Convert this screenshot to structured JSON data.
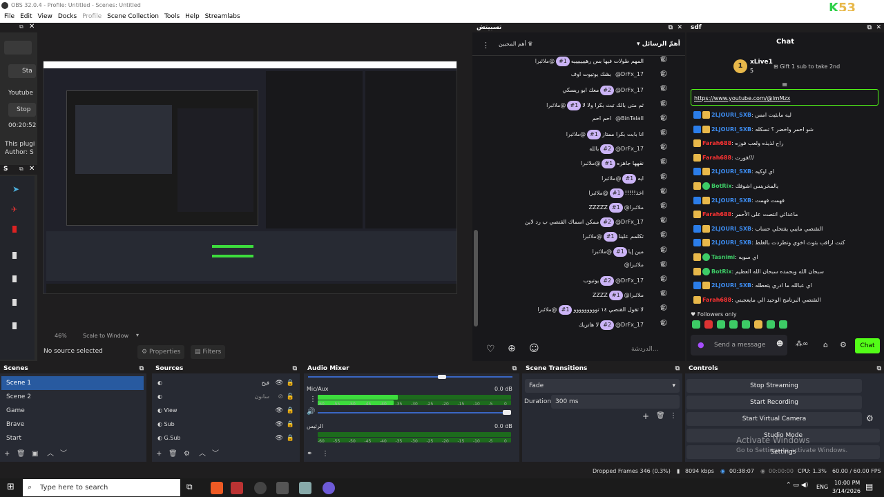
{
  "titlebar": {
    "title": "OBS 32.0.4 - Profile: Untitled - Scenes: Untitled",
    "brand": "53",
    "brand_k": "K"
  },
  "menu": {
    "items": [
      "File",
      "Edit",
      "View",
      "Docks",
      "Profile",
      "Scene Collection",
      "Tools",
      "Help",
      "Streamlabs"
    ]
  },
  "leftdock": {
    "start_label": "Sta",
    "youtube_label": "Youtube",
    "stop_label": "Stop",
    "timer": "00:20:52",
    "plugin_text": "This plugi",
    "author_text": "Author: S",
    "dock2_title": "S"
  },
  "preview": {
    "zoom": "46%",
    "scale_mode": "Scale to Window",
    "no_source": "No source selected",
    "properties": "Properties",
    "filters": "Filters",
    "inner_caption": "Activate Windows"
  },
  "chatpop": {
    "title": "تسبيتش",
    "filter_label": "أهمّ الرسائل",
    "top_btn": "أهم المحبين",
    "input_placeholder": "الدردشة...",
    "lines": [
      {
        "user": "@ملائبرا",
        "rank": "#1",
        "text": "المهم طولات فيها بس رهيييييييه"
      },
      {
        "user": "@DrFx_17",
        "rank": "",
        "text": "بشك يوتيوت اوف"
      },
      {
        "user": "@DrFx_17",
        "rank": "#2",
        "text": "معك ابو ريسكي"
      },
      {
        "user": "@ملائبرا",
        "rank": "#1",
        "text": "ثم متى بالك تبث بكرا ولا لا"
      },
      {
        "user": "@BinTalall",
        "rank": "",
        "text": "احم احم"
      },
      {
        "user": "@ملائبرا",
        "rank": "#1",
        "text": "انا بابت بكرا ممتاز"
      },
      {
        "user": "@DrFx_17",
        "rank": "#2",
        "text": "بالله"
      },
      {
        "user": "@ملائبرا",
        "rank": "#1",
        "text": "نقهها جاهزه"
      },
      {
        "user": "@ملائبرا",
        "rank": "#1",
        "text": "ايه"
      },
      {
        "user": "@ملائبرا",
        "rank": "#1",
        "text": "اخذ!!!!!"
      },
      {
        "user": "@ملائبرا",
        "rank": "#1",
        "text": "ZZZZZ"
      },
      {
        "user": "@DrFx_17",
        "rank": "#2",
        "text": "ممكن اسماك القنصي ب رد لاين"
      },
      {
        "user": "@ملائبرا",
        "rank": "#1",
        "text": "تكلمم علينا"
      },
      {
        "user": "@ملائبرا",
        "rank": "#1",
        "text": "مين إيا"
      },
      {
        "user": "@ملائبرا",
        "rank": "",
        "text": ""
      },
      {
        "user": "@DrFx_17",
        "rank": "#2",
        "text": "يوتيوب"
      },
      {
        "user": "@ملائبرا",
        "rank": "#1",
        "text": "ZZZZ"
      },
      {
        "user": "@ملائبرا",
        "rank": "#1",
        "text": "لا تقول القنصي ١٤ تووووووووو"
      },
      {
        "user": "@DrFx_17",
        "rank": "#2",
        "text": "لا هاتريك"
      }
    ]
  },
  "sdf": {
    "title": "sdf",
    "chat_title": "Chat",
    "top_user": "xLive1",
    "top_count": "5",
    "gift_text": "Gift 1 sub to take 2nd",
    "link": "https://www.youtube.com/@ImMzx",
    "followers_only": "Followers only",
    "send_placeholder": "Send a message",
    "chat_button": "Chat",
    "messages": [
      {
        "name": "2LJOURI_SXB",
        "color": "blue",
        "text": "ليه مابثيت امس"
      },
      {
        "name": "2LJOURI_SXB",
        "color": "blue",
        "text": "شو احمر واخضر ؟ تسكله"
      },
      {
        "name": "Farah688",
        "color": "red",
        "text": "راح لذيذه ولعب فوزه"
      },
      {
        "name": "Farah688",
        "color": "red",
        "text": "فورت///"
      },
      {
        "name": "2LJOURI_SXB",
        "color": "blue",
        "text": "اي اوكيه"
      },
      {
        "name": "BotRix",
        "color": "grn",
        "text": "يالمخربنس اشوفك"
      },
      {
        "name": "2LJOURI_SXB",
        "color": "blue",
        "text": "فهمت فهمت"
      },
      {
        "name": "Farah688",
        "color": "red",
        "text": "ماعدائي انتصت على الأحمر"
      },
      {
        "name": "2LJOURI_SXB",
        "color": "blue",
        "text": "النقنصي مايبي يفتحلي حساب"
      },
      {
        "name": "2LJOURI_SXB",
        "color": "blue",
        "text": "كنت اراقب بثوث اخوي وتطردت بالغلط"
      },
      {
        "name": "Tasnimi",
        "color": "grn",
        "text": "اي سويه"
      },
      {
        "name": "BotRix",
        "color": "grn",
        "text": "سبحان الله وبحمده سبحان الله العظيم"
      },
      {
        "name": "2LJOURI_SXB",
        "color": "blue",
        "text": "اي عبالله ما ادري يتعطله"
      },
      {
        "name": "Farah688",
        "color": "red",
        "text": "النقنصي البرنامج الوحيد الي مايعجبني"
      }
    ]
  },
  "scenes": {
    "title": "Scenes",
    "items": [
      "Scene 1",
      "Scene 2",
      "Game",
      "Brave",
      "Start"
    ]
  },
  "sources": {
    "title": "Sources",
    "items": [
      "فيح",
      "سانون",
      "View",
      "Sub",
      "G.Sub"
    ]
  },
  "audio": {
    "title": "Audio Mixer",
    "ch1": "Mic/Aux",
    "ch1_db": "0.0 dB",
    "ch2": "الرئيس",
    "ch2_db": "0.0 dB",
    "ticks": [
      "-60",
      "-55",
      "-50",
      "-45",
      "-40",
      "-35",
      "-30",
      "-25",
      "-20",
      "-15",
      "-10",
      "-5",
      "0"
    ]
  },
  "transitions": {
    "title": "Scene Transitions",
    "type": "Fade",
    "duration_label": "Duration",
    "duration": "300 ms"
  },
  "controls": {
    "title": "Controls",
    "buttons": [
      "Stop Streaming",
      "Start Recording",
      "Start Virtual Camera",
      "Studio Mode",
      "Settings"
    ],
    "watermark1": "Activate Windows",
    "watermark2": "Go to Settings to activate Windows."
  },
  "status": {
    "dropped": "Dropped Frames 346 (0.3%)",
    "bitrate": "8094 kbps",
    "live_time": "00:38:07",
    "rec_time": "00:00:00",
    "cpu": "CPU: 1.3%",
    "fps": "60.00 / 60.00 FPS"
  },
  "taskbar": {
    "search": "Type here to search",
    "lang": "ENG",
    "time": "10:00 PM",
    "date": "3/14/2026"
  },
  "colors": {
    "accent": "#285aa0",
    "twitch": "#cbb4f6",
    "kick_green": "#53fc18",
    "meter_green": "#3ddc3d"
  }
}
